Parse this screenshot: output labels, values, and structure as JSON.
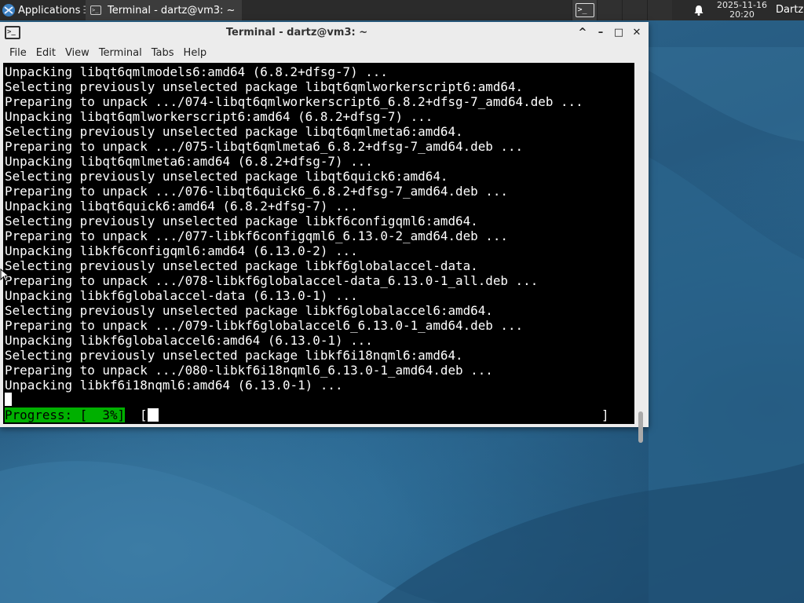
{
  "panel": {
    "applications_label": "Applications",
    "applications_sep": "☰",
    "task_title": "Terminal - dartz@vm3: ~",
    "clock_date": "2025-11-16",
    "clock_time": "20:20",
    "user": "Dartz",
    "task_icon": "terminal-icon",
    "notification_icon": "bell-icon"
  },
  "window": {
    "title": "Terminal - dartz@vm3: ~",
    "controls": {
      "shade": "^",
      "minimize": "–",
      "maximize": "□",
      "close": "✕"
    },
    "menu": [
      "File",
      "Edit",
      "View",
      "Terminal",
      "Tabs",
      "Help"
    ]
  },
  "terminal": {
    "lines": [
      "Unpacking libqt6qmlmodels6:amd64 (6.8.2+dfsg-7) ...",
      "Selecting previously unselected package libqt6qmlworkerscript6:amd64.",
      "Preparing to unpack .../074-libqt6qmlworkerscript6_6.8.2+dfsg-7_amd64.deb ...",
      "Unpacking libqt6qmlworkerscript6:amd64 (6.8.2+dfsg-7) ...",
      "Selecting previously unselected package libqt6qmlmeta6:amd64.",
      "Preparing to unpack .../075-libqt6qmlmeta6_6.8.2+dfsg-7_amd64.deb ...",
      "Unpacking libqt6qmlmeta6:amd64 (6.8.2+dfsg-7) ...",
      "Selecting previously unselected package libqt6quick6:amd64.",
      "Preparing to unpack .../076-libqt6quick6_6.8.2+dfsg-7_amd64.deb ...",
      "Unpacking libqt6quick6:amd64 (6.8.2+dfsg-7) ...",
      "Selecting previously unselected package libkf6configqml6:amd64.",
      "Preparing to unpack .../077-libkf6configqml6_6.13.0-2_amd64.deb ...",
      "Unpacking libkf6configqml6:amd64 (6.13.0-2) ...",
      "Selecting previously unselected package libkf6globalaccel-data.",
      "Preparing to unpack .../078-libkf6globalaccel-data_6.13.0-1_all.deb ...",
      "Unpacking libkf6globalaccel-data (6.13.0-1) ...",
      "Selecting previously unselected package libkf6globalaccel6:amd64.",
      "Preparing to unpack .../079-libkf6globalaccel6_6.13.0-1_amd64.deb ...",
      "Unpacking libkf6globalaccel6:amd64 (6.13.0-1) ...",
      "Selecting previously unselected package libkf6i18nqml6:amd64.",
      "Preparing to unpack .../080-libkf6i18nqml6_6.13.0-1_amd64.deb ...",
      "Unpacking libkf6i18nqml6:amd64 (6.13.0-1) ..."
    ],
    "progress_label": "Progress: [  3%]",
    "progress_open": "[",
    "progress_close": "]",
    "progress_percent": 3
  },
  "colors": {
    "progress_bg": "#00b000",
    "terminal_bg": "#000000",
    "panel_bg": "#2b2b2b"
  }
}
